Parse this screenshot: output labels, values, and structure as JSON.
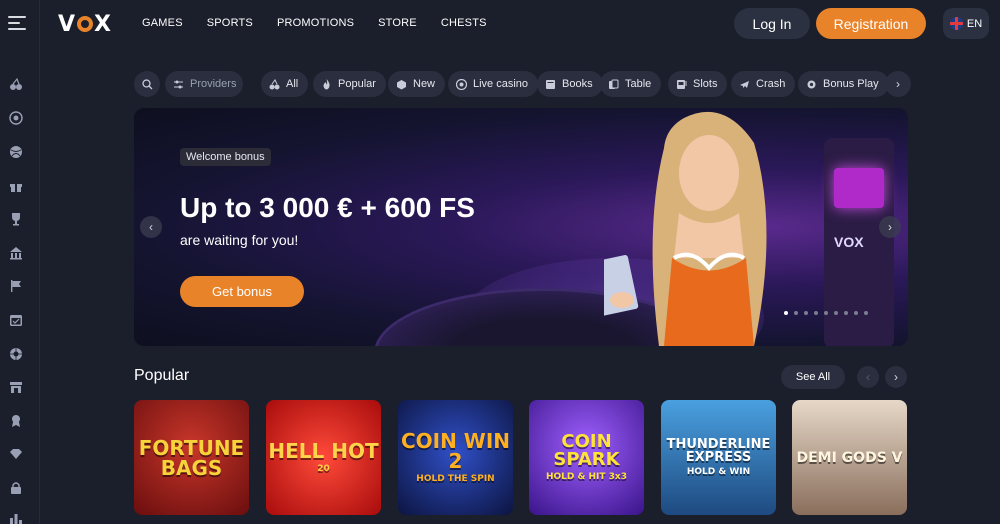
{
  "header": {
    "logo": "VOX",
    "nav": [
      "GAMES",
      "SPORTS",
      "PROMOTIONS",
      "STORE",
      "CHESTS"
    ],
    "login_label": "Log In",
    "register_label": "Registration",
    "language": "EN"
  },
  "sidebar": {
    "icons": [
      "cherries-icon",
      "target-icon",
      "ball-icon",
      "gift-icon",
      "trophy-icon",
      "casino-icon",
      "race-flag-icon",
      "calendar-icon",
      "roulette-icon",
      "store-icon",
      "badge-icon",
      "diamond-icon",
      "lock-icon",
      "chart-icon"
    ]
  },
  "filters": {
    "providers": "Providers",
    "categories": [
      "All",
      "Popular",
      "New",
      "Live casino",
      "Books",
      "Table",
      "Slots",
      "Crash",
      "Bonus Play"
    ]
  },
  "banner": {
    "badge": "Welcome bonus",
    "title": "Up to 3 000 € + 600 FS",
    "subtitle": "are waiting for you!",
    "cta": "Get bonus",
    "slides": 9,
    "active_slide": 1
  },
  "popular": {
    "title": "Popular",
    "see_all": "See All",
    "games": [
      {
        "title": "FORTUNE BAGS",
        "subtitle": "",
        "bg": "#8e1c1c"
      },
      {
        "title": "HELL HOT",
        "subtitle": "20",
        "bg": "#d41e1e"
      },
      {
        "title": "COIN WIN 2",
        "subtitle": "HOLD THE SPIN",
        "bg": "#14205a"
      },
      {
        "title": "COIN SPARK",
        "subtitle": "HOLD & HIT 3x3",
        "bg": "#4b1f9a"
      },
      {
        "title": "THUNDERLINE EXPRESS",
        "subtitle": "HOLD & WIN",
        "bg": "#2c6ea8"
      },
      {
        "title": "DEMI GODS V",
        "subtitle": "",
        "bg": "#b49a86"
      }
    ]
  },
  "colors": {
    "accent": "#e8832a",
    "background": "#1b1e2b",
    "chip": "#2a2e3e"
  }
}
